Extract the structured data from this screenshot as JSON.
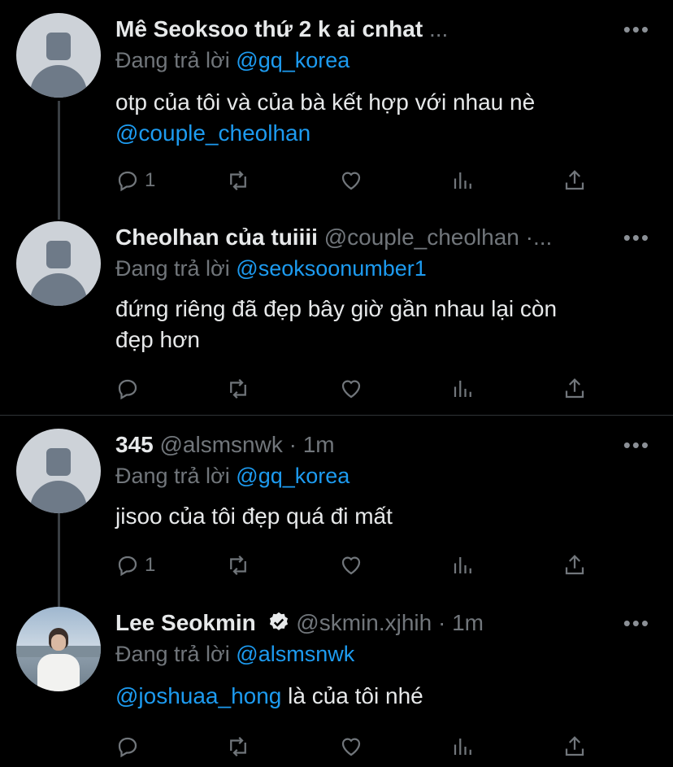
{
  "tweets": [
    {
      "name": "Mê Seoksoo thứ 2 k ai cnhat",
      "handle": "",
      "trail": "...",
      "reply_prefix": "Đang trả lời",
      "reply_handle": "@gq_korea",
      "text_line1": "otp của tôi và của bà kết hợp với nhau nè",
      "text_line2_mention": "@couple_cheolhan",
      "reply_count": "1"
    },
    {
      "name": "Cheolhan của tuiiii",
      "handle": "@couple_cheolhan",
      "trail": "·...",
      "reply_prefix": "Đang trả lời",
      "reply_handle": "@seoksoonumber1",
      "text_line1": "đứng riêng đã đẹp bây giờ gần nhau lại còn",
      "text_line2": "đẹp hơn",
      "reply_count": ""
    },
    {
      "name": "345",
      "handle": "@alsmsnwk",
      "dot": "·",
      "time": "1m",
      "reply_prefix": "Đang trả lời",
      "reply_handle": "@gq_korea",
      "text_line1": "jisoo của tôi đẹp quá đi mất",
      "reply_count": "1"
    },
    {
      "name": "Lee Seokmin",
      "handle": "@skmin.xjhih",
      "dot": "·",
      "time": "1m",
      "reply_prefix": "Đang trả lời",
      "reply_handle": "@alsmsnwk",
      "text_mention": "@joshuaa_hong",
      "text_rest": " là của tôi nhé",
      "reply_count": ""
    }
  ],
  "more_label": "•••",
  "colors": {
    "background": "#000000",
    "text": "#e7e9ea",
    "muted": "#71767b",
    "accent": "#1d9bf0",
    "separator": "#2f3336"
  },
  "icons": [
    "reply-icon",
    "retweet-icon",
    "like-icon",
    "stats-icon",
    "share-icon",
    "more-icon",
    "verified-icon"
  ]
}
